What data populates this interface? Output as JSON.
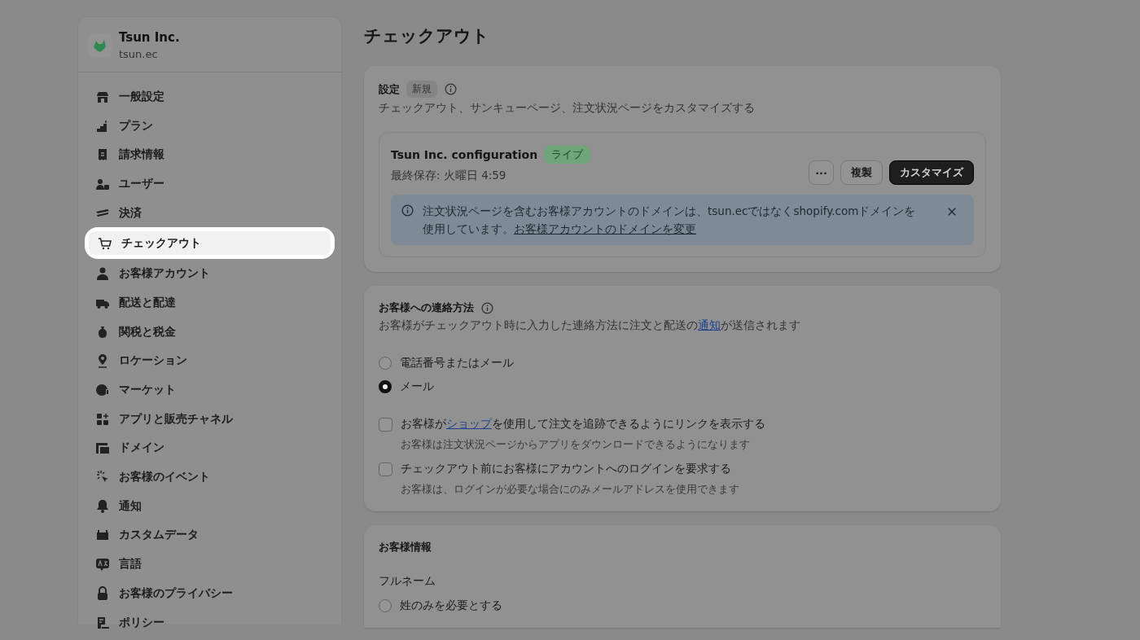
{
  "store": {
    "name": "Tsun Inc.",
    "domain": "tsun.ec"
  },
  "sidebar": {
    "items": [
      {
        "label": "一般設定",
        "selected": false
      },
      {
        "label": "プラン",
        "selected": false
      },
      {
        "label": "請求情報",
        "selected": false
      },
      {
        "label": "ユーザー",
        "selected": false
      },
      {
        "label": "決済",
        "selected": false
      },
      {
        "label": "チェックアウト",
        "selected": true
      },
      {
        "label": "お客様アカウント",
        "selected": false
      },
      {
        "label": "配送と配達",
        "selected": false
      },
      {
        "label": "関税と税金",
        "selected": false
      },
      {
        "label": "ロケーション",
        "selected": false
      },
      {
        "label": "マーケット",
        "selected": false
      },
      {
        "label": "アプリと販売チャネル",
        "selected": false
      },
      {
        "label": "ドメイン",
        "selected": false
      },
      {
        "label": "お客様のイベント",
        "selected": false
      },
      {
        "label": "通知",
        "selected": false
      },
      {
        "label": "カスタムデータ",
        "selected": false
      },
      {
        "label": "言語",
        "selected": false
      },
      {
        "label": "お客様のプライバシー",
        "selected": false
      },
      {
        "label": "ポリシー",
        "selected": false
      }
    ]
  },
  "page_title": "チェックアウト",
  "config_card": {
    "title": "設定",
    "badge": "新規",
    "description": "チェックアウト、サンキューページ、注文状況ページをカスタマイズする",
    "configuration": {
      "name": "Tsun Inc. configuration",
      "status": "ライブ",
      "saved": "最終保存: 火曜日 4:59",
      "more_button": "···",
      "duplicate_button": "複製",
      "customize_button": "カスタマイズ"
    },
    "banner": {
      "text": "注文状況ページを含むお客様アカウントのドメインは、tsun.ecではなくshopify.comドメインを使用しています。",
      "link": "お客様アカウントのドメインを変更"
    }
  },
  "contact_card": {
    "title": "お客様への連絡方法",
    "description_before": "お客様がチェックアウト時に入力した連絡方法に注文と配送の",
    "description_link": "通知",
    "description_after": "が送信されます",
    "radios": [
      {
        "label": "電話番号またはメール",
        "selected": false
      },
      {
        "label": "メール",
        "selected": true
      }
    ],
    "checkboxes": [
      {
        "label_before": "お客様が",
        "label_link": "ショップ",
        "label_after": "を使用して注文を追跡できるようにリンクを表示する",
        "help": "お客様は注文状況ページからアプリをダウンロードできるようになります",
        "checked": false
      },
      {
        "label_before": "チェックアウト前にお客様にアカウントへのログインを要求する",
        "help": "お客様は、ログインが必要な場合にのみメールアドレスを使用できます",
        "checked": false
      }
    ]
  },
  "customer_card": {
    "title": "お客様情報",
    "field_label": "フルネーム",
    "radios": [
      {
        "label": "姓のみを必要とする",
        "selected": false
      }
    ]
  }
}
